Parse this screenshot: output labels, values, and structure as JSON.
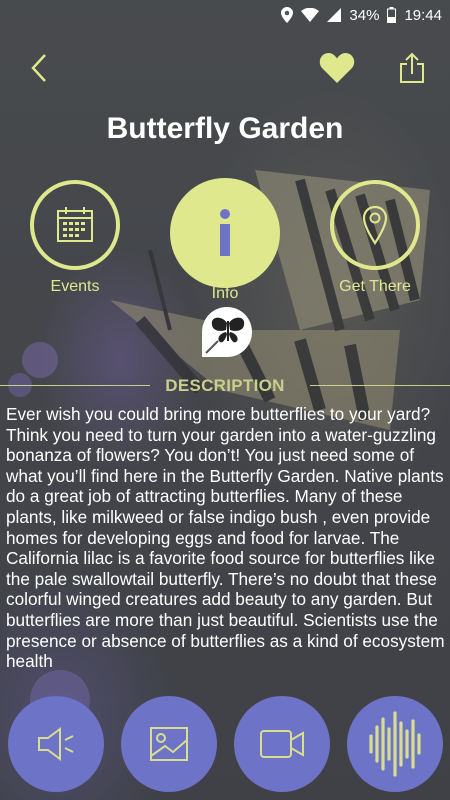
{
  "status_bar": {
    "battery": "34%",
    "time": "19:44",
    "icons": [
      "location-icon",
      "wifi-icon",
      "signal-icon",
      "battery-icon"
    ]
  },
  "header": {
    "title": "Butterfly Garden",
    "icons": [
      "back-chevron-icon",
      "heart-icon",
      "share-icon"
    ]
  },
  "nav": {
    "events_label": "Events",
    "info_label": "Info",
    "get_there_label": "Get There"
  },
  "description": {
    "heading": "DESCRIPTION",
    "body": "Ever wish you could bring more butterflies to your yard? Think you need to turn your garden into a water-guzzling bonanza of flowers?  You don’t! You just need some of what you’ll find here in the Butterfly Garden. Native plants do a great job of attracting butterflies. Many of these plants, like milkweed or false indigo bush , even provide homes for developing eggs and food for larvae. The California lilac is a favorite food source for butterflies like the pale swallowtail butterfly. There’s no doubt that these colorful winged creatures add beauty to any garden. But butterflies are more than just beautiful. Scientists use the presence or absence of butterflies as a kind of ecosystem health"
  },
  "media": {
    "icons": [
      "audio-icon",
      "image-icon",
      "video-icon",
      "soundwave-icon"
    ]
  },
  "colors": {
    "accent": "#dfe88c",
    "media_button": "#6d73c6",
    "info_glyph": "#6d73c6"
  }
}
